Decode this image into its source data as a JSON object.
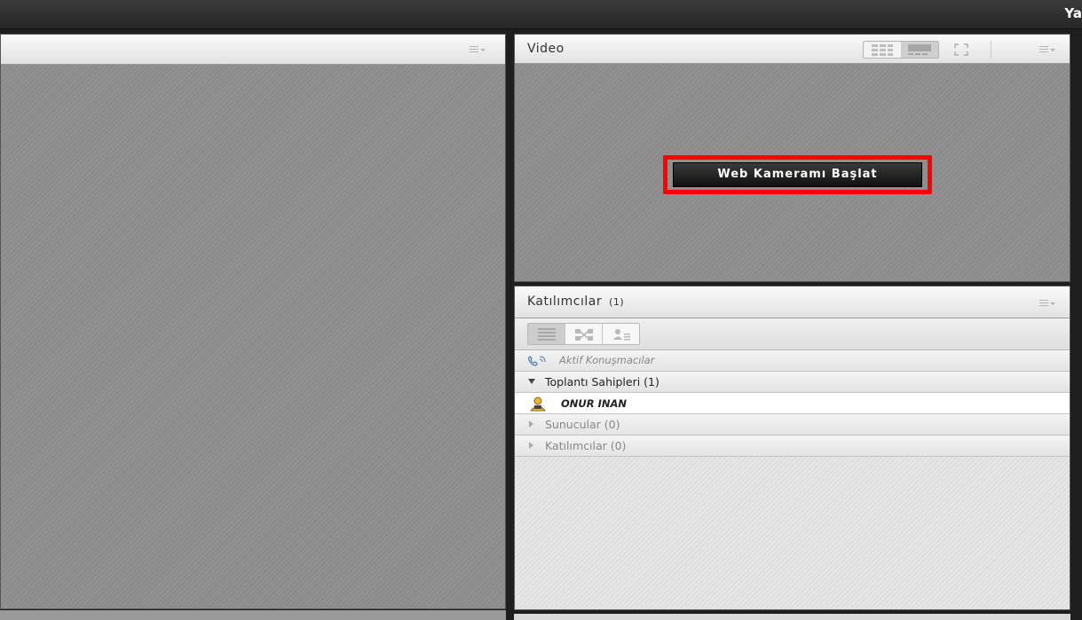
{
  "window": {
    "top_right_text": "Ya"
  },
  "video_pod": {
    "title": "Video",
    "start_webcam_label": "Web Kameramı Başlat"
  },
  "attendees_pod": {
    "title": "Katılımcılar",
    "count": "(1)",
    "active_speakers_label": "Aktif Konuşmacılar",
    "groups": [
      {
        "label": "Toplantı Sahipleri (1)",
        "expanded": true
      },
      {
        "label": "Sunucular (0)",
        "expanded": false
      },
      {
        "label": "Katılımcılar (0)",
        "expanded": false
      }
    ],
    "host_user": "ONUR INAN"
  },
  "icons": {
    "menu": "pod-menu-icon",
    "grid_view": "grid-view-icon",
    "single_view": "single-view-icon",
    "fullscreen": "fullscreen-icon",
    "list_view": "list-view-icon",
    "breakout": "breakout-icon",
    "status": "status-icon",
    "phone": "phone-icon",
    "host": "host-user-icon"
  },
  "colors": {
    "highlight": "#ff0000",
    "stage_bg": "#8c8c8c"
  }
}
